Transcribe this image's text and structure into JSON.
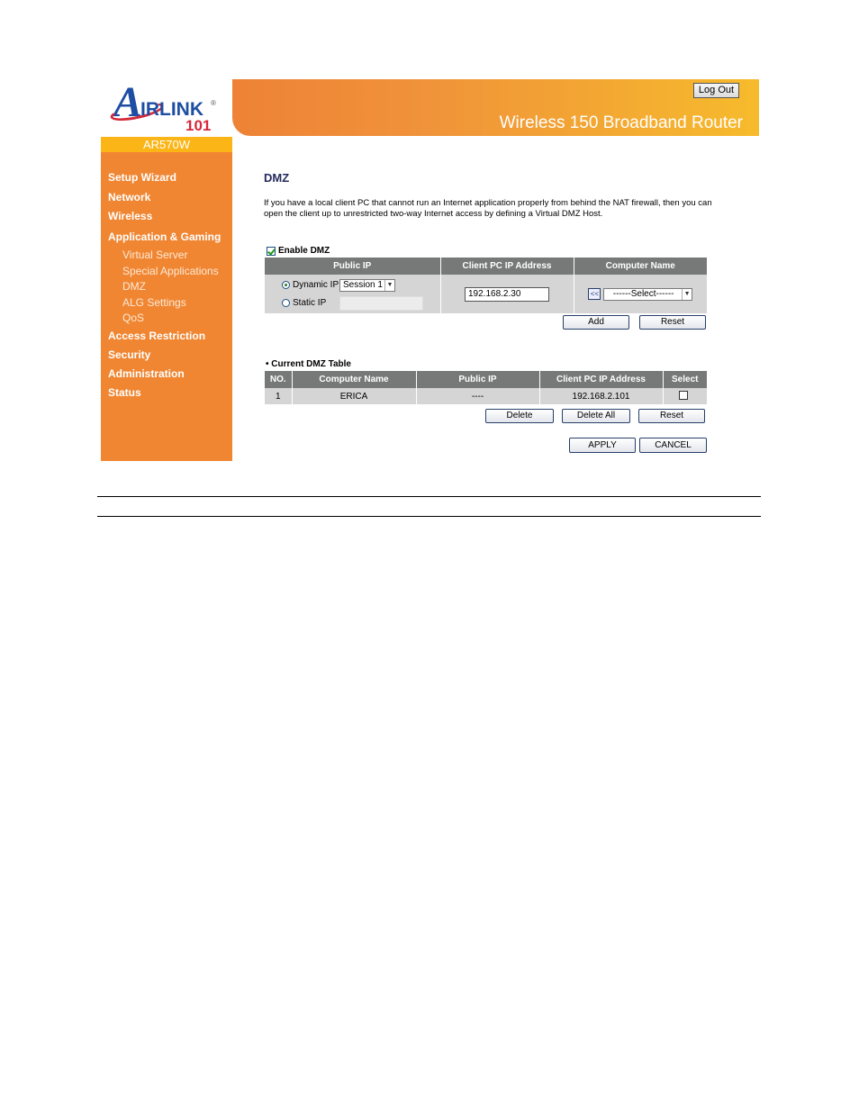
{
  "brand": {
    "logo_letter": "A",
    "logo_text": "IRLINK",
    "logo_reg": "®",
    "logo_number": "101",
    "model": "AR570W"
  },
  "header": {
    "title": "Wireless 150 Broadband Router",
    "logout_label": "Log Out"
  },
  "sidebar": {
    "items": [
      {
        "label": "Setup Wizard",
        "level": "main"
      },
      {
        "label": "Network",
        "level": "main"
      },
      {
        "label": "Wireless",
        "level": "main"
      },
      {
        "label": "Application & Gaming",
        "level": "main"
      },
      {
        "label": "Virtual Server",
        "level": "sub"
      },
      {
        "label": "Special Applications",
        "level": "sub"
      },
      {
        "label": "DMZ",
        "level": "sub",
        "active": true
      },
      {
        "label": "ALG Settings",
        "level": "sub"
      },
      {
        "label": "QoS",
        "level": "sub"
      },
      {
        "label": "Access Restriction",
        "level": "main"
      },
      {
        "label": "Security",
        "level": "main"
      },
      {
        "label": "Administration",
        "level": "main"
      },
      {
        "label": "Status",
        "level": "main"
      }
    ]
  },
  "main": {
    "title": "DMZ",
    "description": "If you have a local client PC that cannot run an Internet application properly from behind the NAT firewall, then you can open the client up to unrestricted two-way Internet access by defining a Virtual DMZ Host.",
    "enable_dmz": {
      "label": "Enable DMZ",
      "checked": true
    },
    "form": {
      "headers": [
        "Public IP",
        "Client PC IP Address",
        "Computer Name"
      ],
      "dynamic_ip": {
        "label": "Dynamic IP",
        "selected": true,
        "session_value": "Session 1"
      },
      "static_ip": {
        "label": "Static IP",
        "selected": false,
        "value": ""
      },
      "client_ip_value": "192.168.2.30",
      "copy_button": "<<",
      "computer_select_value": "------Select------",
      "add_label": "Add",
      "reset_label": "Reset"
    },
    "current_table": {
      "label": "Current DMZ Table",
      "headers": [
        "NO.",
        "Computer Name",
        "Public IP",
        "Client PC IP Address",
        "Select"
      ],
      "rows": [
        {
          "no": "1",
          "computer_name": "ERICA",
          "public_ip": "----",
          "client_ip": "192.168.2.101",
          "selected": false
        }
      ],
      "delete_label": "Delete",
      "delete_all_label": "Delete All",
      "reset_label": "Reset"
    },
    "apply_label": "APPLY",
    "cancel_label": "CANCEL"
  }
}
